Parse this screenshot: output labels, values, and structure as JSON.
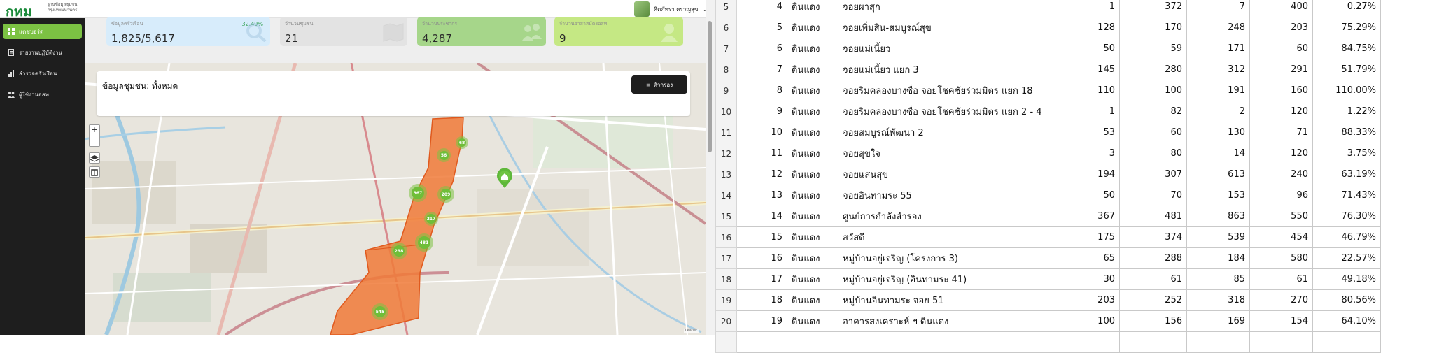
{
  "header": {
    "logo": "กทม",
    "logo_sub_line1": "ฐานข้อมูลชุมชน",
    "logo_sub_line2": "กรุงเทพมหานคร",
    "user_name": "ศิตภัทรา ครวญสุข"
  },
  "sidebar": {
    "items": [
      {
        "label": "แดชบอร์ด",
        "icon": "grid-icon",
        "active": true
      },
      {
        "label": "รายงานปฏิบัติงาน",
        "icon": "document-icon",
        "active": false
      },
      {
        "label": "สำรวจครัวเรือน",
        "icon": "bar-chart-icon",
        "active": false
      },
      {
        "label": "ผู้ใช้งานอสท.",
        "icon": "users-icon",
        "active": false
      }
    ]
  },
  "stats": [
    {
      "label": "ข้อมูลครัวเรือน",
      "value": "1,825/5,617",
      "percent": "32.49%",
      "color": "#d7ecfb"
    },
    {
      "label": "จำนวนชุมชน",
      "value": "21",
      "percent": "",
      "color": "#e3e3e3"
    },
    {
      "label": "จำนวนประชากร",
      "value": "4,287",
      "percent": "",
      "color": "#a6d68a"
    },
    {
      "label": "จำนวนอาสาสมัครอสท.",
      "value": "9",
      "percent": "",
      "color": "#c5e884"
    }
  ],
  "map": {
    "panel_title": "ข้อมูลชุมชน: ทั้งหมด",
    "filter_label": "ตัวกรอง",
    "zoom_in": "+",
    "zoom_out": "−",
    "attribution": "Leaflet",
    "clusters": [
      "56",
      "68",
      "367",
      "209",
      "217",
      "481",
      "298",
      "545"
    ],
    "zone_color": "#f07a38"
  },
  "table": {
    "rows": [
      {
        "rn": "5",
        "no": "4",
        "district": "ดินแดง",
        "name": "จอยผาสุก",
        "a": "1",
        "b": "372",
        "c": "7",
        "d": "400",
        "pct": "0.27%"
      },
      {
        "rn": "6",
        "no": "5",
        "district": "ดินแดง",
        "name": "จอยเพิ่มสิน-สมบูรณ์สุข",
        "a": "128",
        "b": "170",
        "c": "248",
        "d": "203",
        "pct": "75.29%"
      },
      {
        "rn": "7",
        "no": "6",
        "district": "ดินแดง",
        "name": "จอยแม่เนี้ยว",
        "a": "50",
        "b": "59",
        "c": "171",
        "d": "60",
        "pct": "84.75%"
      },
      {
        "rn": "8",
        "no": "7",
        "district": "ดินแดง",
        "name": "จอยแม่เนี้ยว แยก 3",
        "a": "145",
        "b": "280",
        "c": "312",
        "d": "291",
        "pct": "51.79%"
      },
      {
        "rn": "9",
        "no": "8",
        "district": "ดินแดง",
        "name": "จอยริมคลองบางซื่อ จอยโชคชัยร่วมมิตร แยก 18",
        "a": "110",
        "b": "100",
        "c": "191",
        "d": "160",
        "pct": "110.00%"
      },
      {
        "rn": "10",
        "no": "9",
        "district": "ดินแดง",
        "name": "จอยริมคลองบางซื่อ จอยโชคชัยร่วมมิตร แยก 2 - 4",
        "a": "1",
        "b": "82",
        "c": "2",
        "d": "120",
        "pct": "1.22%"
      },
      {
        "rn": "11",
        "no": "10",
        "district": "ดินแดง",
        "name": "จอยสมบูรณ์พัฒนา 2",
        "a": "53",
        "b": "60",
        "c": "130",
        "d": "71",
        "pct": "88.33%"
      },
      {
        "rn": "12",
        "no": "11",
        "district": "ดินแดง",
        "name": "จอยสุขใจ",
        "a": "3",
        "b": "80",
        "c": "14",
        "d": "120",
        "pct": "3.75%"
      },
      {
        "rn": "13",
        "no": "12",
        "district": "ดินแดง",
        "name": "จอยแสนสุข",
        "a": "194",
        "b": "307",
        "c": "613",
        "d": "240",
        "pct": "63.19%"
      },
      {
        "rn": "14",
        "no": "13",
        "district": "ดินแดง",
        "name": "จอยอินทามระ 55",
        "a": "50",
        "b": "70",
        "c": "153",
        "d": "96",
        "pct": "71.43%"
      },
      {
        "rn": "15",
        "no": "14",
        "district": "ดินแดง",
        "name": "ศูนย์การกำลังสำรอง",
        "a": "367",
        "b": "481",
        "c": "863",
        "d": "550",
        "pct": "76.30%"
      },
      {
        "rn": "16",
        "no": "15",
        "district": "ดินแดง",
        "name": "สวัสดี",
        "a": "175",
        "b": "374",
        "c": "539",
        "d": "454",
        "pct": "46.79%"
      },
      {
        "rn": "17",
        "no": "16",
        "district": "ดินแดง",
        "name": "หมู่บ้านอยู่เจริญ (โครงการ 3)",
        "a": "65",
        "b": "288",
        "c": "184",
        "d": "580",
        "pct": "22.57%"
      },
      {
        "rn": "18",
        "no": "17",
        "district": "ดินแดง",
        "name": "หมู่บ้านอยู่เจริญ (อินทามระ 41)",
        "a": "30",
        "b": "61",
        "c": "85",
        "d": "61",
        "pct": "49.18%"
      },
      {
        "rn": "19",
        "no": "18",
        "district": "ดินแดง",
        "name": "หมู่บ้านอินทามระ จอย 51",
        "a": "203",
        "b": "252",
        "c": "318",
        "d": "270",
        "pct": "80.56%"
      },
      {
        "rn": "20",
        "no": "19",
        "district": "ดินแดง",
        "name": "อาคารสงเคราะห์ ฯ ดินแดง",
        "a": "100",
        "b": "156",
        "c": "169",
        "d": "154",
        "pct": "64.10%"
      },
      {
        "rn": "",
        "no": "",
        "district": "",
        "name": "",
        "a": "",
        "b": "",
        "c": "",
        "d": "",
        "pct": ""
      }
    ]
  }
}
